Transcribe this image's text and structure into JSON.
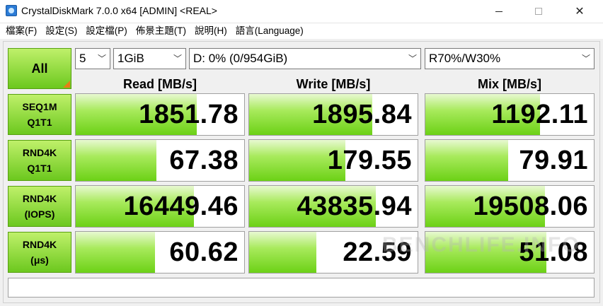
{
  "window": {
    "title": "CrystalDiskMark 7.0.0 x64 [ADMIN] <REAL>",
    "icon": "crystaldiskmark-icon",
    "minimize_glyph": "",
    "maximize_glyph": "",
    "close_glyph": "✕"
  },
  "menu": [
    "檔案(F)",
    "設定(S)",
    "設定檔(P)",
    "佈景主題(T)",
    "說明(H)",
    "語言(Language)"
  ],
  "controls": {
    "all_label": "All",
    "count_value": "5",
    "size_value": "1GiB",
    "drive_value": "D: 0% (0/954GiB)",
    "mix_value": "R70%/W30%",
    "chevron": "﹀"
  },
  "headers": {
    "read": "Read [MB/s]",
    "write": "Write [MB/s]",
    "mix": "Mix [MB/s]"
  },
  "rows": [
    {
      "line1": "SEQ1M",
      "line2": "Q1T1",
      "read": "1851.78",
      "write": "1895.84",
      "mix": "1192.11",
      "read_level": 0.72,
      "write_level": 0.73,
      "mix_level": 0.68
    },
    {
      "line1": "RND4K",
      "line2": "Q1T1",
      "read": "67.38",
      "write": "179.55",
      "mix": "79.91",
      "read_level": 0.48,
      "write_level": 0.57,
      "mix_level": 0.49
    },
    {
      "line1": "RND4K",
      "line2": "(IOPS)",
      "read": "16449.46",
      "write": "43835.94",
      "mix": "19508.06",
      "read_level": 0.7,
      "write_level": 0.75,
      "mix_level": 0.71
    },
    {
      "line1": "RND4K",
      "line2": "(μs)",
      "read": "60.62",
      "write": "22.59",
      "mix": "51.08",
      "read_level": 0.47,
      "write_level": 0.4,
      "mix_level": 0.72
    }
  ],
  "comment": "",
  "watermark": "BENCHLIFE.INFO",
  "colors": {
    "accent_green": "#6cc81e",
    "fill_green": "#6cd116",
    "corner_orange": "#e87d16"
  }
}
